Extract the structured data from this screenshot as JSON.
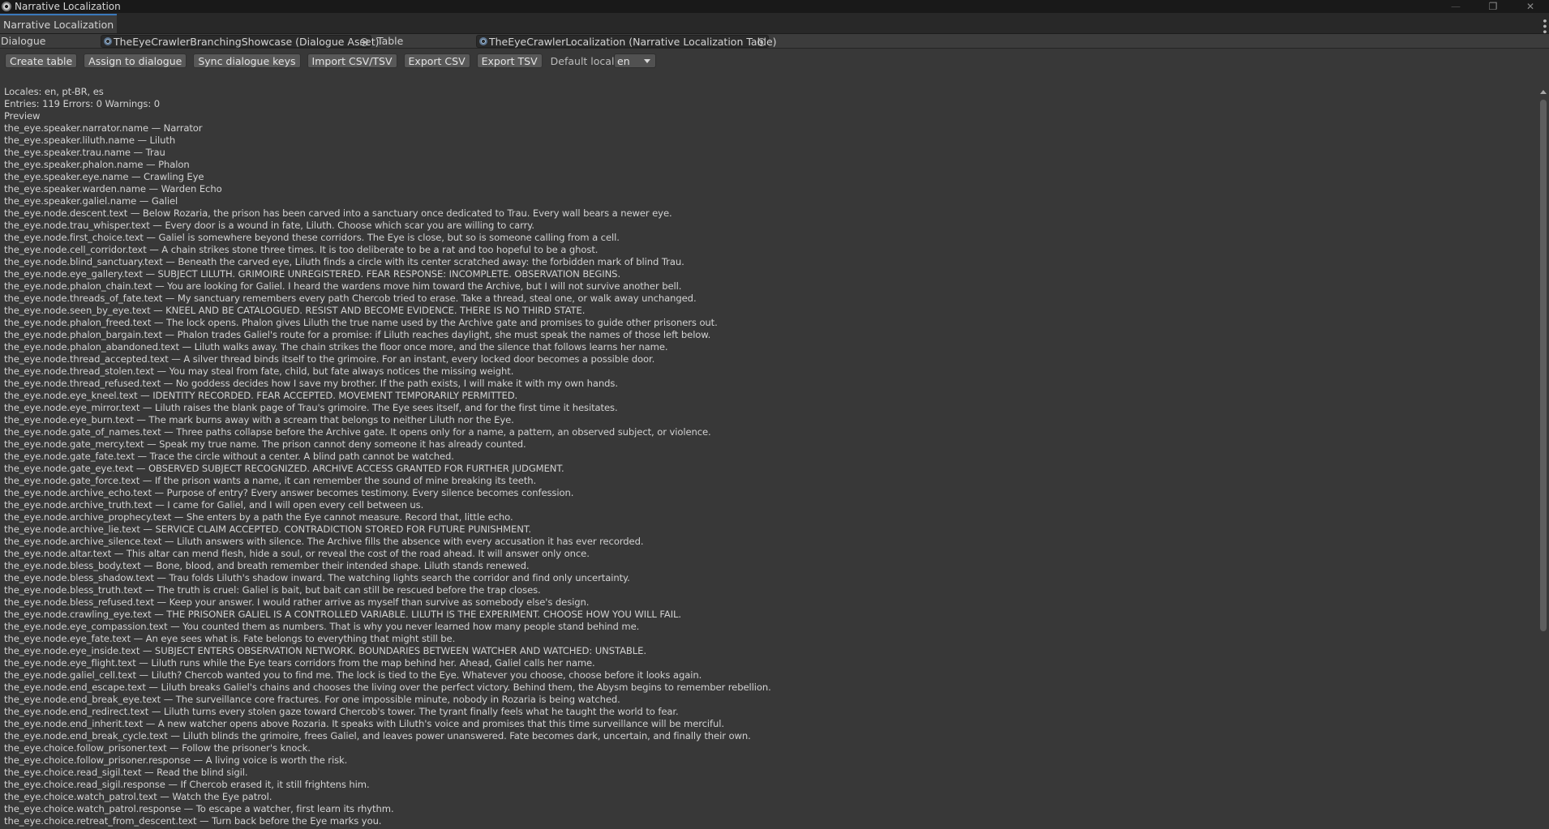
{
  "window": {
    "title": "Narrative Localization",
    "minimize_glyph": "—",
    "restore_glyph": "❐",
    "close_glyph": "✕"
  },
  "window_tab": {
    "label": "Narrative Localization"
  },
  "assets": {
    "dialogue_label": "Dialogue",
    "dialogue_value": "TheEyeCrawlerBranchingShowcase (Dialogue Asset)",
    "table_label": "Table",
    "table_value": "TheEyeCrawlerLocalization (Narrative Localization Table)"
  },
  "toolbar": {
    "create_table": "Create table",
    "assign": "Assign to dialogue",
    "sync": "Sync dialogue keys",
    "import": "Import CSV/TSV",
    "export_csv": "Export CSV",
    "export_tsv": "Export TSV",
    "default_locale_label": "Default locale",
    "default_locale_value": "en"
  },
  "summary": {
    "locales": "Locales: en, pt-BR, es",
    "stats": "Entries: 119 Errors: 0 Warnings: 0",
    "preview_heading": "Preview"
  },
  "preview_lines": [
    "the_eye.speaker.narrator.name — Narrator",
    "the_eye.speaker.liluth.name — Liluth",
    "the_eye.speaker.trau.name — Trau",
    "the_eye.speaker.phalon.name — Phalon",
    "the_eye.speaker.eye.name — Crawling Eye",
    "the_eye.speaker.warden.name — Warden Echo",
    "the_eye.speaker.galiel.name — Galiel",
    "the_eye.node.descent.text — Below Rozaria, the prison has been carved into a sanctuary once dedicated to Trau. Every wall bears a newer eye.",
    "the_eye.node.trau_whisper.text — Every door is a wound in fate, Liluth. Choose which scar you are willing to carry.",
    "the_eye.node.first_choice.text — Galiel is somewhere beyond these corridors. The Eye is close, but so is someone calling from a cell.",
    "the_eye.node.cell_corridor.text — A chain strikes stone three times. It is too deliberate to be a rat and too hopeful to be a ghost.",
    "the_eye.node.blind_sanctuary.text — Beneath the carved eye, Liluth finds a circle with its center scratched away: the forbidden mark of blind Trau.",
    "the_eye.node.eye_gallery.text — SUBJECT LILUTH. GRIMOIRE UNREGISTERED. FEAR RESPONSE: INCOMPLETE. OBSERVATION BEGINS.",
    "the_eye.node.phalon_chain.text — You are looking for Galiel. I heard the wardens move him toward the Archive, but I will not survive another bell.",
    "the_eye.node.threads_of_fate.text — My sanctuary remembers every path Chercob tried to erase. Take a thread, steal one, or walk away unchanged.",
    "the_eye.node.seen_by_eye.text — KNEEL AND BE CATALOGUED. RESIST AND BECOME EVIDENCE. THERE IS NO THIRD STATE.",
    "the_eye.node.phalon_freed.text — The lock opens. Phalon gives Liluth the true name used by the Archive gate and promises to guide other prisoners out.",
    "the_eye.node.phalon_bargain.text — Phalon trades Galiel's route for a promise: if Liluth reaches daylight, she must speak the names of those left below.",
    "the_eye.node.phalon_abandoned.text — Liluth walks away. The chain strikes the floor once more, and the silence that follows learns her name.",
    "the_eye.node.thread_accepted.text — A silver thread binds itself to the grimoire. For an instant, every locked door becomes a possible door.",
    "the_eye.node.thread_stolen.text — You may steal from fate, child, but fate always notices the missing weight.",
    "the_eye.node.thread_refused.text — No goddess decides how I save my brother. If the path exists, I will make it with my own hands.",
    "the_eye.node.eye_kneel.text — IDENTITY RECORDED. FEAR ACCEPTED. MOVEMENT TEMPORARILY PERMITTED.",
    "the_eye.node.eye_mirror.text — Liluth raises the blank page of Trau's grimoire. The Eye sees itself, and for the first time it hesitates.",
    "the_eye.node.eye_burn.text — The mark burns away with a scream that belongs to neither Liluth nor the Eye.",
    "the_eye.node.gate_of_names.text — Three paths collapse before the Archive gate. It opens only for a name, a pattern, an observed subject, or violence.",
    "the_eye.node.gate_mercy.text — Speak my true name. The prison cannot deny someone it has already counted.",
    "the_eye.node.gate_fate.text — Trace the circle without a center. A blind path cannot be watched.",
    "the_eye.node.gate_eye.text — OBSERVED SUBJECT RECOGNIZED. ARCHIVE ACCESS GRANTED FOR FURTHER JUDGMENT.",
    "the_eye.node.gate_force.text — If the prison wants a name, it can remember the sound of mine breaking its teeth.",
    "the_eye.node.archive_echo.text — Purpose of entry? Every answer becomes testimony. Every silence becomes confession.",
    "the_eye.node.archive_truth.text — I came for Galiel, and I will open every cell between us.",
    "the_eye.node.archive_prophecy.text — She enters by a path the Eye cannot measure. Record that, little echo.",
    "the_eye.node.archive_lie.text — SERVICE CLAIM ACCEPTED. CONTRADICTION STORED FOR FUTURE PUNISHMENT.",
    "the_eye.node.archive_silence.text — Liluth answers with silence. The Archive fills the absence with every accusation it has ever recorded.",
    "the_eye.node.altar.text — This altar can mend flesh, hide a soul, or reveal the cost of the road ahead. It will answer only once.",
    "the_eye.node.bless_body.text — Bone, blood, and breath remember their intended shape. Liluth stands renewed.",
    "the_eye.node.bless_shadow.text — Trau folds Liluth's shadow inward. The watching lights search the corridor and find only uncertainty.",
    "the_eye.node.bless_truth.text — The truth is cruel: Galiel is bait, but bait can still be rescued before the trap closes.",
    "the_eye.node.bless_refused.text — Keep your answer. I would rather arrive as myself than survive as somebody else's design.",
    "the_eye.node.crawling_eye.text — THE PRISONER GALIEL IS A CONTROLLED VARIABLE. LILUTH IS THE EXPERIMENT. CHOOSE HOW YOU WILL FAIL.",
    "the_eye.node.eye_compassion.text — You counted them as numbers. That is why you never learned how many people stand behind me.",
    "the_eye.node.eye_fate.text — An eye sees what is. Fate belongs to everything that might still be.",
    "the_eye.node.eye_inside.text — SUBJECT ENTERS OBSERVATION NETWORK. BOUNDARIES BETWEEN WATCHER AND WATCHED: UNSTABLE.",
    "the_eye.node.eye_flight.text — Liluth runs while the Eye tears corridors from the map behind her. Ahead, Galiel calls her name.",
    "the_eye.node.galiel_cell.text — Liluth? Chercob wanted you to find me. The lock is tied to the Eye. Whatever you choose, choose before it looks again.",
    "the_eye.node.end_escape.text — Liluth breaks Galiel's chains and chooses the living over the perfect victory. Behind them, the Abysm begins to remember rebellion.",
    "the_eye.node.end_break_eye.text — The surveillance core fractures. For one impossible minute, nobody in Rozaria is being watched.",
    "the_eye.node.end_redirect.text — Liluth turns every stolen gaze toward Chercob's tower. The tyrant finally feels what he taught the world to fear.",
    "the_eye.node.end_inherit.text — A new watcher opens above Rozaria. It speaks with Liluth's voice and promises that this time surveillance will be merciful.",
    "the_eye.node.end_break_cycle.text — Liluth blinds the grimoire, frees Galiel, and leaves power unanswered. Fate becomes dark, uncertain, and finally their own.",
    "the_eye.choice.follow_prisoner.text — Follow the prisoner's knock.",
    "the_eye.choice.follow_prisoner.response — A living voice is worth the risk.",
    "the_eye.choice.read_sigil.text — Read the blind sigil.",
    "the_eye.choice.read_sigil.response — If Chercob erased it, it still frightens him.",
    "the_eye.choice.watch_patrol.text — Watch the Eye patrol.",
    "the_eye.choice.watch_patrol.response — To escape a watcher, first learn its rhythm.",
    "the_eye.choice.retreat_from_descent.text — Turn back before the Eye marks you."
  ]
}
